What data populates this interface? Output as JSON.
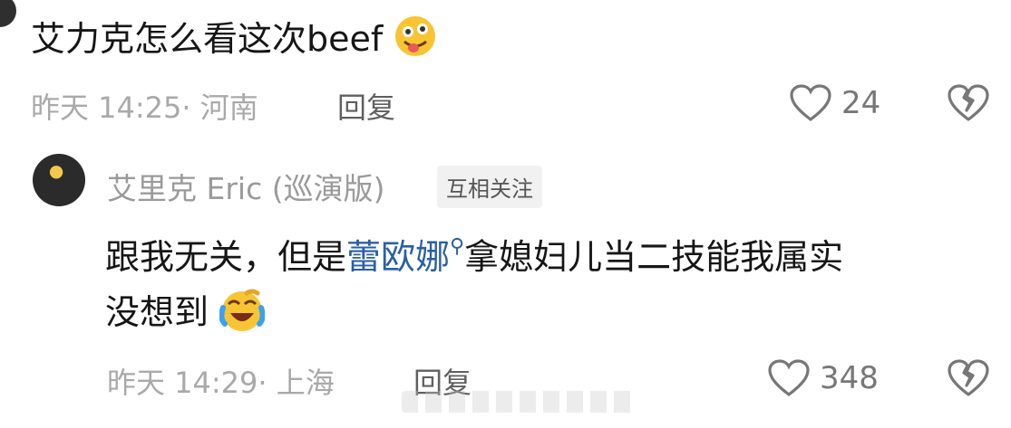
{
  "comment1": {
    "text": "艾力克怎么看这次beef",
    "emoji_icon": "tongue-out-emoji-icon",
    "time": "昨天 14:25",
    "location": "· 河南",
    "reply_label": "回复",
    "likes": "24"
  },
  "reply1": {
    "username": "艾里克 Eric (巡演版)",
    "badge": "互相关注",
    "text_part1": "跟我无关，但是",
    "mention": "蕾欧娜",
    "text_part2": "拿媳妇儿当二技能我属实",
    "text_line2": "没想到",
    "emoji_icon": "laughing-crying-emoji-icon",
    "time": "昨天 14:29",
    "location": "· 上海",
    "reply_label": "回复",
    "likes": "348"
  },
  "colors": {
    "text": "#161616",
    "meta": "#a9a9a9",
    "mention": "#2a5fa6",
    "badge_bg": "#f1f1f1"
  }
}
